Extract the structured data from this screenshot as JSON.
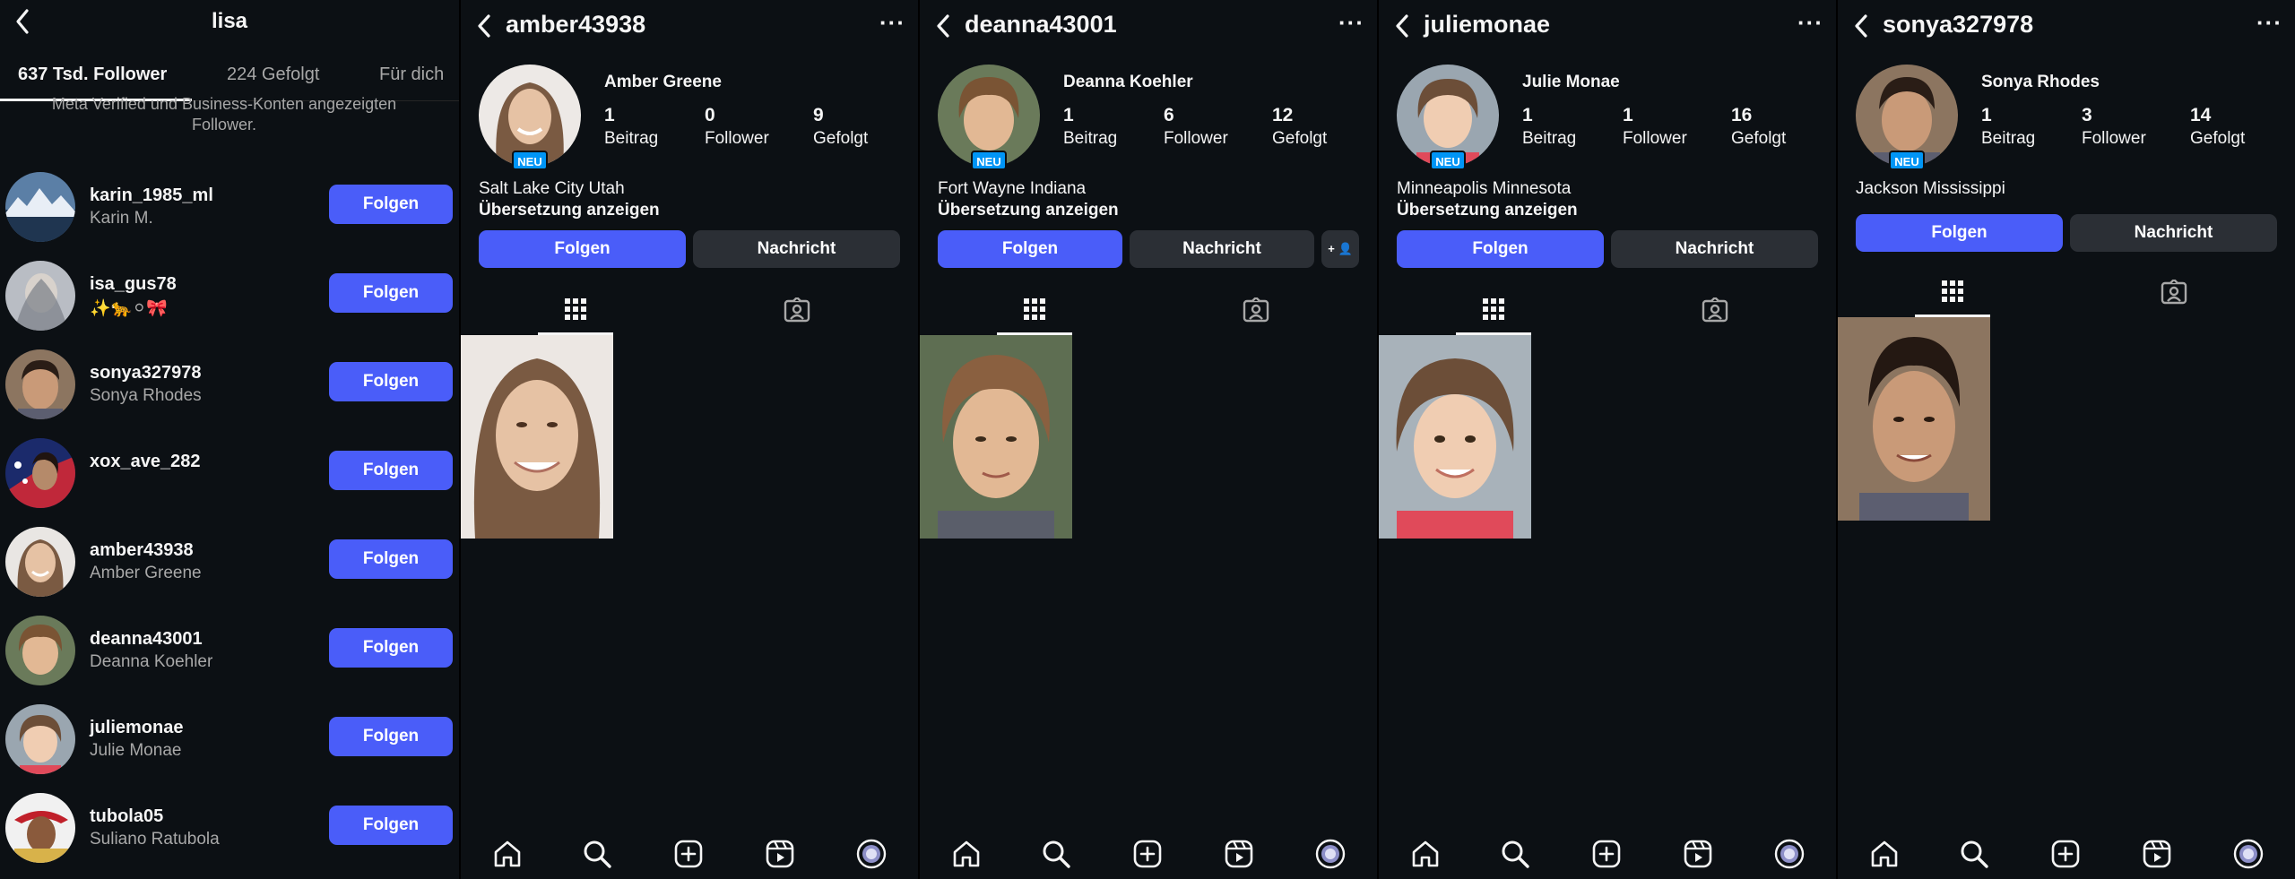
{
  "followers_panel": {
    "title": "lisa",
    "tabs": [
      {
        "label": "637 Tsd. Follower"
      },
      {
        "label": "224 Gefolgt"
      },
      {
        "label": "Für dich"
      }
    ],
    "note": "Meta Verified und Business-Konten angezeigten Follower.",
    "follow_label": "Folgen",
    "rows": [
      {
        "username": "karin_1985_ml",
        "fullname": "Karin M."
      },
      {
        "username": "isa_gus78",
        "fullname": "✨🐆⚪🎀"
      },
      {
        "username": "sonya327978",
        "fullname": "Sonya Rhodes"
      },
      {
        "username": "xox_ave_282",
        "fullname": ""
      },
      {
        "username": "amber43938",
        "fullname": "Amber Greene"
      },
      {
        "username": "deanna43001",
        "fullname": "Deanna Koehler"
      },
      {
        "username": "juliemonae",
        "fullname": "Julie Monae"
      },
      {
        "username": "tubola05",
        "fullname": "Suliano Ratubola"
      }
    ]
  },
  "profiles": [
    {
      "username": "amber43938",
      "name": "Amber Greene",
      "badge": "NEU",
      "posts": "1",
      "posts_label": "Beitrag",
      "followers": "0",
      "followers_label": "Follower",
      "following": "9",
      "following_label": "Gefolgt",
      "location": "Salt Lake City Utah",
      "translate": "Übersetzung anzeigen",
      "follow": "Folgen",
      "message": "Nachricht",
      "more": "···"
    },
    {
      "username": "deanna43001",
      "name": "Deanna Koehler",
      "badge": "NEU",
      "posts": "1",
      "posts_label": "Beitrag",
      "followers": "6",
      "followers_label": "Follower",
      "following": "12",
      "following_label": "Gefolgt",
      "location": "Fort Wayne Indiana",
      "translate": "Übersetzung anzeigen",
      "follow": "Folgen",
      "message": "Nachricht",
      "more": "···",
      "add_user": "+ 👤"
    },
    {
      "username": "juliemonae",
      "name": "Julie Monae",
      "badge": "NEU",
      "posts": "1",
      "posts_label": "Beitrag",
      "followers": "1",
      "followers_label": "Follower",
      "following": "16",
      "following_label": "Gefolgt",
      "location": "Minneapolis Minnesota",
      "translate": "Übersetzung anzeigen",
      "follow": "Folgen",
      "message": "Nachricht",
      "more": "···"
    },
    {
      "username": "sonya327978",
      "name": "Sonya Rhodes",
      "badge": "NEU",
      "posts": "1",
      "posts_label": "Beitrag",
      "followers": "3",
      "followers_label": "Follower",
      "following": "14",
      "following_label": "Gefolgt",
      "location": "Jackson Mississippi",
      "follow": "Folgen",
      "message": "Nachricht",
      "more": "···"
    }
  ],
  "colors": {
    "background": "#0c1014",
    "follow_button": "#4a5df9",
    "message_button": "#2b2f35",
    "badge": "#0095f6",
    "muted_text": "#a8a8a8"
  },
  "icons": [
    "back-chevron-icon",
    "more-dots-icon",
    "grid-icon",
    "tagged-icon",
    "home-icon",
    "search-icon",
    "create-icon",
    "reels-icon",
    "profile-icon"
  ]
}
